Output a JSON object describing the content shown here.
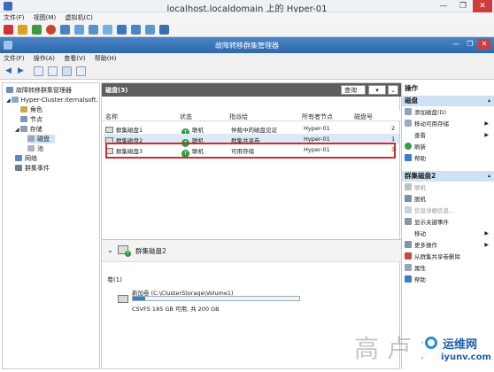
{
  "vm_window": {
    "title": "localhost.localdomain 上的 Hyper-01",
    "menu": [
      "文件(F)",
      "视图(M)",
      "虚拟机(C)"
    ],
    "minimize": "—",
    "restore": "❐",
    "close": "✕"
  },
  "fcm": {
    "title": "故障转移群集管理器",
    "menu": [
      "文件(F)",
      "操作(A)",
      "查看(V)",
      "帮助(H)"
    ],
    "minimize": "—",
    "restore": "❐",
    "close": "✕"
  },
  "tree": {
    "root": "故障转移群集管理器",
    "cluster": "Hyper-Cluster.iternalsoft.",
    "roles": "角色",
    "nodes": "节点",
    "storage": "存储",
    "disks": "磁盘",
    "pools": "池",
    "network": "网络",
    "events": "群集事件"
  },
  "main": {
    "header": "磁盘(3)",
    "query_button": "查询",
    "save_button": "▾",
    "collapse_button": "⌄",
    "columns": [
      "名称",
      "状态",
      "指派给",
      "所有者节点",
      "磁盘号"
    ],
    "rows": [
      {
        "name": "群集磁盘1",
        "status": "联机",
        "assigned": "仲裁中的磁盘见证",
        "owner": "Hyper-01",
        "disk": "2"
      },
      {
        "name": "群集磁盘2",
        "status": "联机",
        "assigned": "群集共享卷",
        "owner": "Hyper-01",
        "disk": "1"
      },
      {
        "name": "群集磁盘3",
        "status": "联机",
        "assigned": "可用存储",
        "owner": "Hyper-01",
        "disk": "3"
      }
    ]
  },
  "detail": {
    "title": "群集磁盘2",
    "volume_label": "卷(1)",
    "volume_name": "新加卷 (C:\\ClusterStorage\\Volume1)",
    "volume_info": "CSVFS 185 GB 可用, 共 200 GB",
    "usage_fraction": 0.075
  },
  "actions": {
    "header": "操作",
    "section1": "磁盘",
    "section1_items": [
      "添加磁盘(D)",
      "移动可用存储",
      "查看",
      "刷新",
      "帮助"
    ],
    "section2": "群集磁盘2",
    "section2_items": [
      "联机",
      "脱机",
      "信息详细信息...",
      "显示关键事件",
      "移动",
      "更多操作",
      "从群集共享卷删除",
      "属性",
      "帮助"
    ]
  },
  "watermark": {
    "text": "高 卢 力",
    "brand": "运维网",
    "url": "iyunv.com"
  }
}
